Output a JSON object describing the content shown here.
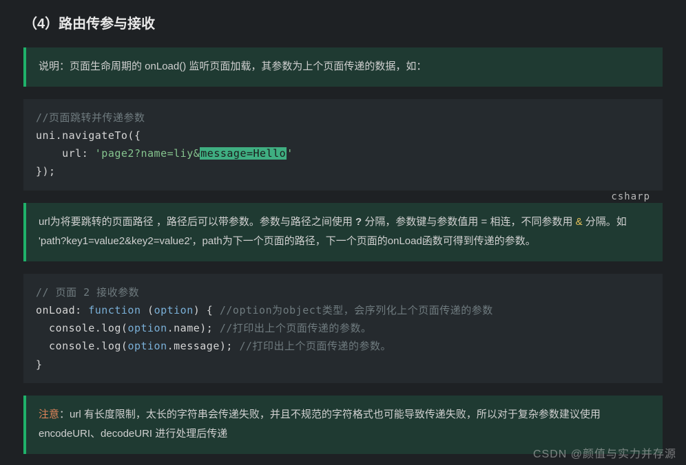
{
  "heading": "（4）路由传参与接收",
  "quote1": {
    "text": "说明：页面生命周期的 onLoad() 监听页面加载，其参数为上个页面传递的数据，如："
  },
  "code1": {
    "comment": "//页面跳转并传递参数",
    "line1_pre": "uni.navigateTo({",
    "line2_key": "    url: ",
    "line2_str_pre": "'page2?name=liy&",
    "line2_str_sel": "message=Hello",
    "line2_str_post": "'",
    "line3": "});",
    "lang": "csharp"
  },
  "quote2": {
    "p1_a": "url为将要跳转的页面路径 ，路径后可以带参数。参数与路径之间使用 ",
    "p1_q": "?",
    "p1_b": " 分隔，参数键与参数值用 = 相连，不同参数用 ",
    "p1_amp": "&",
    "p1_c": " 分隔。如 'path?key1=value2&key2=value2'，path为下一个页面的路径，下一个页面的onLoad函数可得到传递的参数。"
  },
  "code2": {
    "c_line1": "// 页面 2 接收参数",
    "l2_a": "onLoad: ",
    "l2_kw": "function",
    "l2_b": " (",
    "l2_p": "option",
    "l2_c": ") { ",
    "l2_cmt": "//option为object类型，会序列化上个页面传递的参数",
    "l3_a": "  console.log(",
    "l3_p": "option",
    "l3_b": ".name); ",
    "l3_cmt": "//打印出上个页面传递的参数。",
    "l4_a": "  console.log(",
    "l4_p": "option",
    "l4_b": ".message); ",
    "l4_cmt": "//打印出上个页面传递的参数。",
    "l5": "}"
  },
  "quote3": {
    "warn": "注意",
    "text": "：url 有长度限制，太长的字符串会传递失败，并且不规范的字符格式也可能导致传递失败，所以对于复杂参数建议使用 encodeURI、decodeURI 进行处理后传递"
  },
  "watermark": "CSDN @颜值与实力并存源"
}
